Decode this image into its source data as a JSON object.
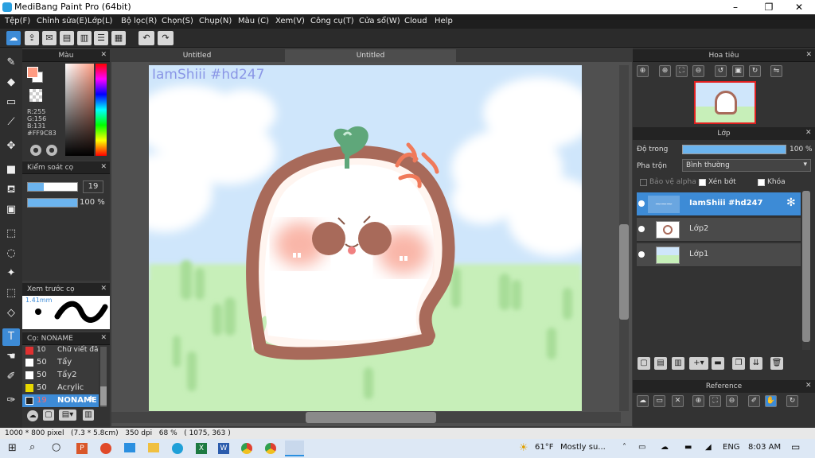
{
  "window": {
    "title": "MediBang Paint Pro (64bit)",
    "min": "–",
    "max": "❐",
    "close": "✕"
  },
  "menu": [
    "Tệp(F)",
    "Chỉnh sửa(E)",
    "Lớp(L)",
    "Bộ lọc(R)",
    "Chọn(S)",
    "Chụp(N)",
    "Màu (C)",
    "Xem(V)",
    "Công cụ(T)",
    "Cửa sổ(W)",
    "Cloud",
    "Help"
  ],
  "color_panel": {
    "title": "Màu",
    "r": "R:255",
    "g": "G:156",
    "b": "B:131",
    "hex": "#FF9C83"
  },
  "brush_control": {
    "title": "Kiểm soát cọ",
    "size": "19",
    "opacity": "100 %",
    "size_fill": 0.32,
    "opacity_fill": 1.0
  },
  "brush_preview": {
    "title": "Xem trước cọ",
    "size": "1.41mm"
  },
  "brush_list": {
    "title": "Cọ: NONAME",
    "items": [
      {
        "size": "10",
        "name": "Chữ viết đã"
      },
      {
        "size": "50",
        "name": "Tẩy"
      },
      {
        "size": "50",
        "name": "Tẩy2"
      },
      {
        "size": "50",
        "name": "Acrylic"
      },
      {
        "size": "19",
        "name": "NONAME"
      }
    ]
  },
  "tabs": [
    "Untitled",
    "Untitled"
  ],
  "canvas": {
    "watermark": "IamShiii #hd247"
  },
  "navigator": {
    "title": "Hoa tiêu"
  },
  "layer_panel": {
    "title": "Lớp",
    "opacity_label": "Độ trong",
    "opacity_value": "100 %",
    "blend_label": "Pha trộn",
    "blend_value": "Bình thường",
    "protect_alpha": "Bảo vệ alpha",
    "clipping": "Xén bớt",
    "lock": "Khóa",
    "layers": [
      {
        "name": "IamShiii #hd247"
      },
      {
        "name": "Lớp2"
      },
      {
        "name": "Lớp1"
      }
    ]
  },
  "reference": {
    "title": "Reference"
  },
  "status": {
    "text": "1000 * 800 pixel   (7.3 * 5.8cm)   350 dpi   68 %   ( 1075, 363 )"
  },
  "taskbar": {
    "temp": "61°F",
    "weather": "Mostly su...",
    "lang": "ENG",
    "time": "8:03 AM"
  },
  "colors": {
    "accent": "#3d8bd6",
    "fg": "#ff9c83",
    "sky": "#cfe6fb",
    "grass": "#c7efb9",
    "outline": "#a86a5a"
  }
}
